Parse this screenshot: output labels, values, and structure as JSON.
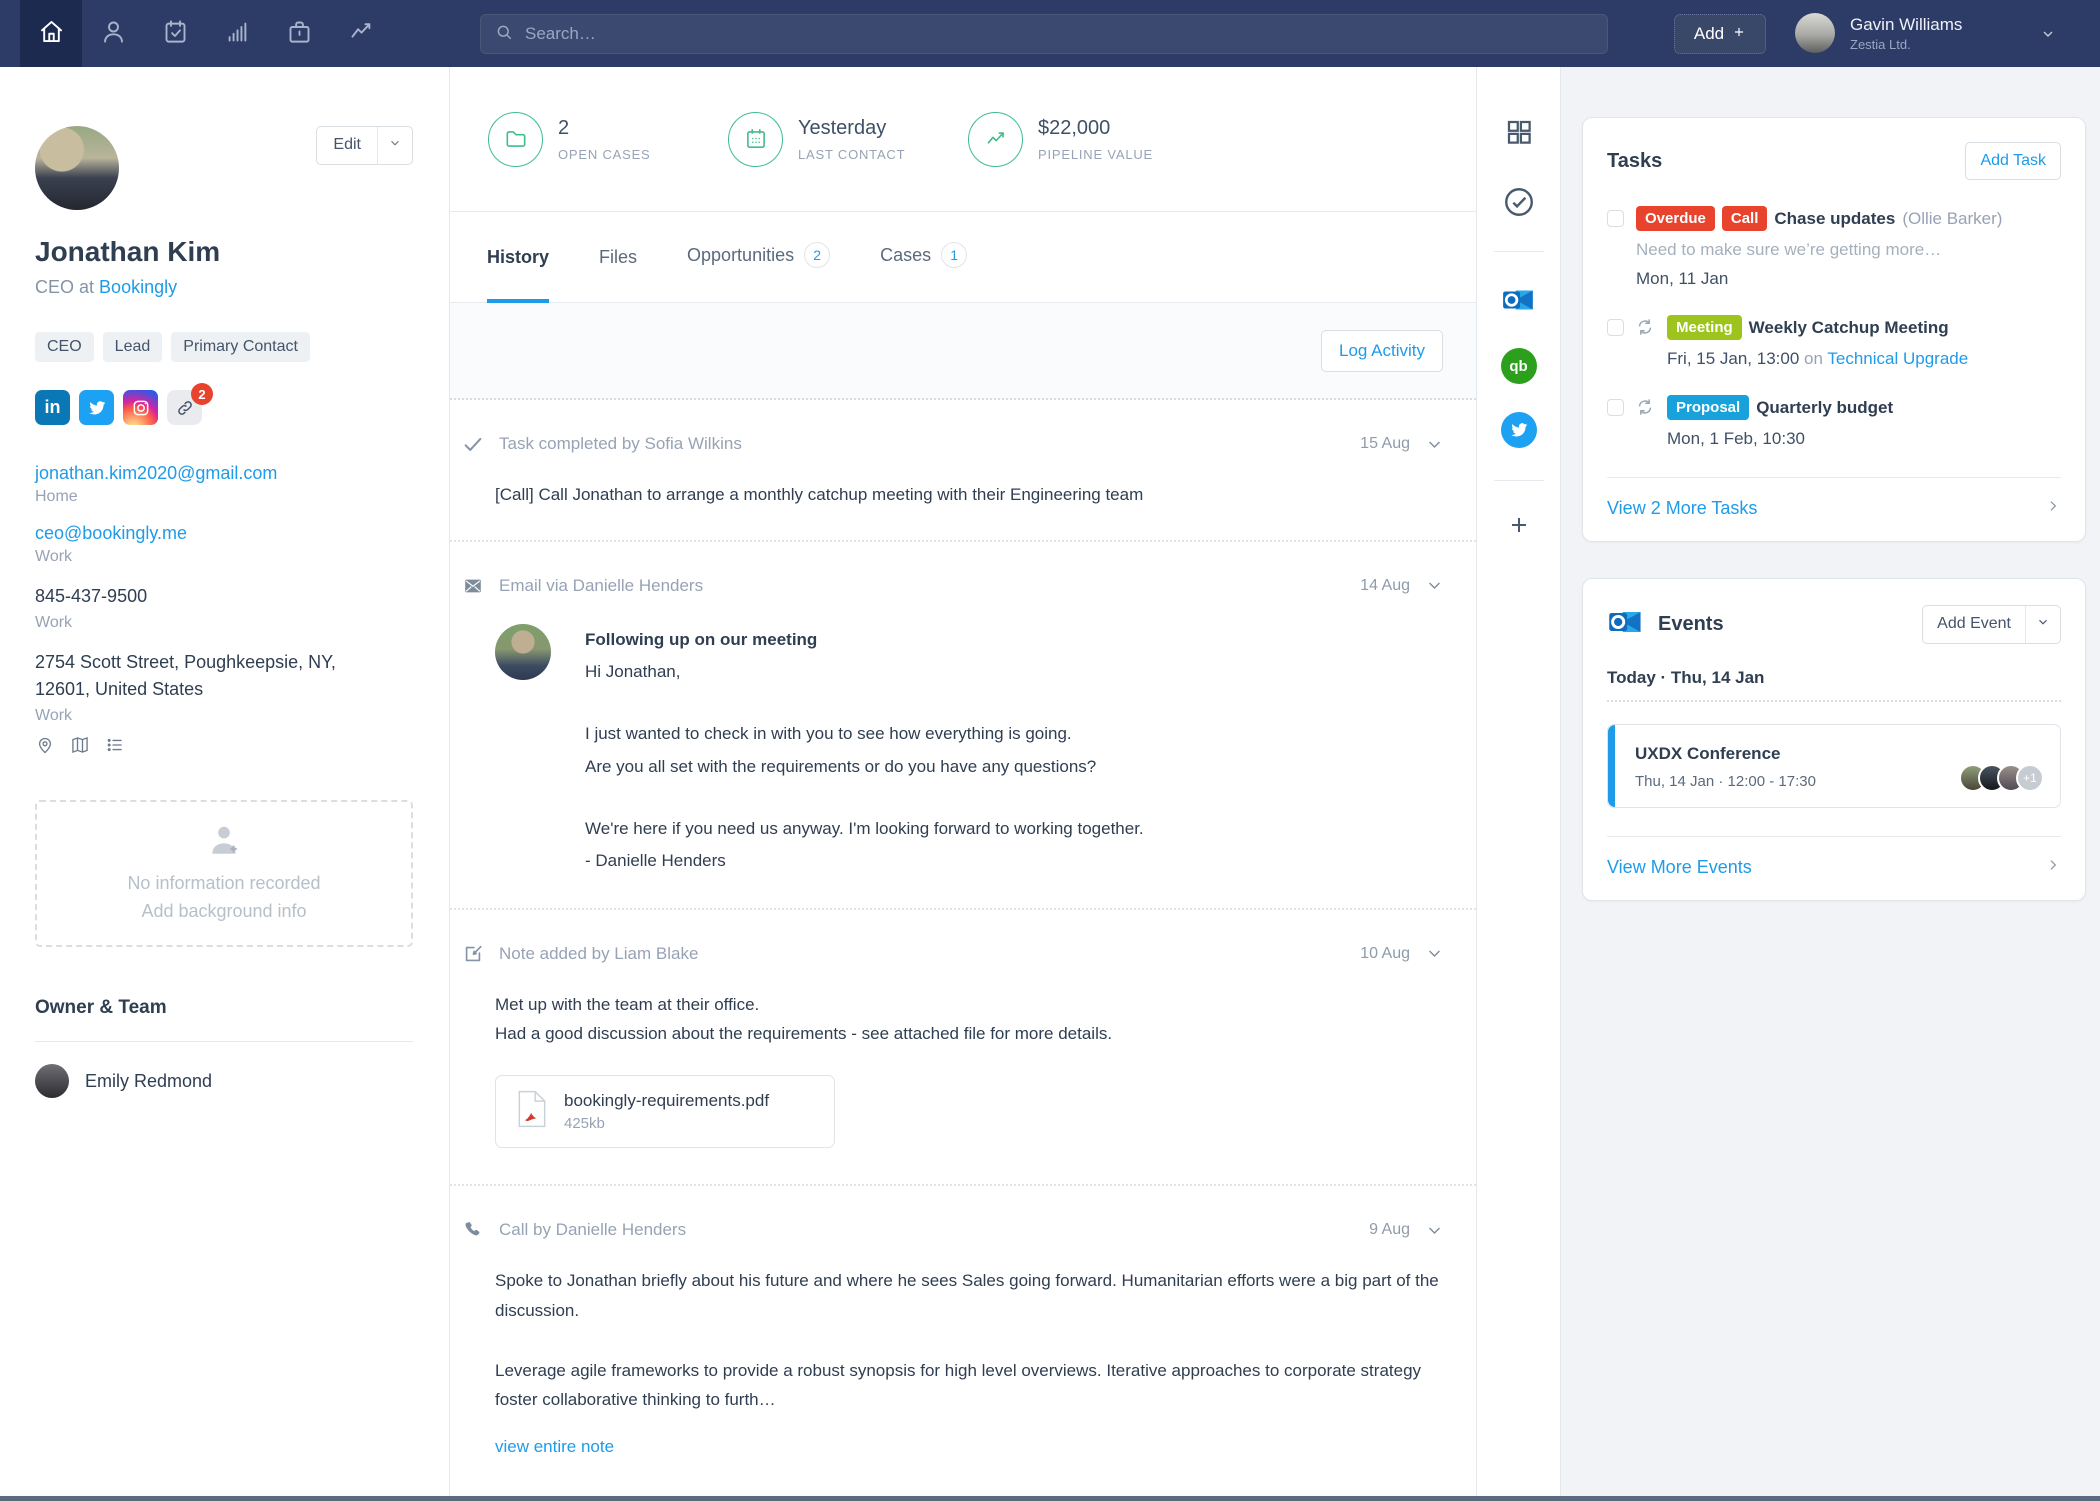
{
  "colors": {
    "navy": "#2d3c66",
    "accent_blue": "#1e9be9",
    "stat_green": "#42bd8c",
    "badge_red": "#e8432d",
    "badge_lime": "#9dc41c",
    "badge_cyan": "#18a2db"
  },
  "nav": {
    "search_placeholder": "Search…",
    "add_label": "Add",
    "user_name": "Gavin Williams",
    "user_org": "Zestia Ltd."
  },
  "sidebar": {
    "edit_label": "Edit",
    "name": "Jonathan Kim",
    "role_prefix": "CEO at",
    "company": "Bookingly",
    "tags": {
      "0": "CEO",
      "1": "Lead",
      "2": "Primary Contact"
    },
    "linkedin_label": "in",
    "social_badge": "2",
    "email_home": {
      "address": "jonathan.kim2020@gmail.com",
      "label": "Home"
    },
    "email_work": {
      "address": "ceo@bookingly.me",
      "label": "Work"
    },
    "phone": {
      "number": "845-437-9500",
      "label": "Work"
    },
    "address": {
      "line1": "2754 Scott Street, Poughkeepsie, NY,",
      "line2": "12601, United States",
      "label": "Work"
    },
    "background": {
      "line1": "No information recorded",
      "line2": "Add background info"
    },
    "owner_heading": "Owner & Team",
    "owner_name": "Emily Redmond"
  },
  "stats": {
    "open_cases": {
      "value": "2",
      "label": "OPEN CASES"
    },
    "last_contact": {
      "value": "Yesterday",
      "label": "LAST CONTACT"
    },
    "pipeline": {
      "value": "$22,000",
      "label": "PIPELINE VALUE"
    }
  },
  "tabs": {
    "history": "History",
    "files": "Files",
    "opportunities": "Opportunities",
    "opportunities_badge": "2",
    "cases": "Cases",
    "cases_badge": "1"
  },
  "main": {
    "log_activity": "Log Activity"
  },
  "timeline": {
    "task": {
      "header": "Task completed by Sofia Wilkins",
      "date": "15 Aug",
      "body": "[Call] Call Jonathan to arrange a monthly catchup meeting with their Engineering team"
    },
    "email": {
      "header": "Email via Danielle Henders",
      "date": "14 Aug",
      "subject": "Following up on our meeting",
      "greeting": "Hi Jonathan,",
      "p1a": "I just wanted to check in with you to see how everything is going.",
      "p1b": "Are you all set with the requirements or do you have any questions?",
      "p2a": "We're here if you need us anyway. I'm looking forward to working together.",
      "p2b": "- Danielle Henders"
    },
    "note": {
      "header": "Note added by Liam Blake",
      "date": "10 Aug",
      "line1": "Met up with the team at their office.",
      "line2": "Had a good discussion about the requirements - see attached file for more details.",
      "file_name": "bookingly-requirements.pdf",
      "file_size": "425kb"
    },
    "call": {
      "header": "Call by Danielle Henders",
      "date": "9 Aug",
      "p1": "Spoke to Jonathan briefly about his future and where he sees Sales going forward. Humanitarian efforts were a big part of the discussion.",
      "p2": "Leverage agile frameworks to provide a robust synopsis for high level overviews. Iterative approaches to corporate strategy foster collaborative thinking to furth…",
      "link": "view entire note"
    }
  },
  "tasks_panel": {
    "title": "Tasks",
    "add_label": "Add Task",
    "task1": {
      "badge1": "Overdue",
      "badge2": "Call",
      "title": "Chase updates",
      "assignee": "(Ollie Barker)",
      "note": "Need to make sure we’re getting more…",
      "date": "Mon, 11 Jan"
    },
    "task2": {
      "badge": "Meeting",
      "title": "Weekly Catchup Meeting",
      "date": "Fri, 15 Jan, 13:00",
      "conj": "on",
      "link": "Technical Upgrade"
    },
    "task3": {
      "badge": "Proposal",
      "title": "Quarterly budget",
      "date": "Mon, 1 Feb, 10:30"
    },
    "more": "View 2 More Tasks"
  },
  "events_panel": {
    "title": "Events",
    "add_label": "Add Event",
    "today": "Today · Thu, 14 Jan",
    "event": {
      "title": "UXDX Conference",
      "time": "Thu, 14 Jan · 12:00 - 17:30",
      "overflow": "+1"
    },
    "more": "View More Events",
    "qb_label": "qb"
  }
}
